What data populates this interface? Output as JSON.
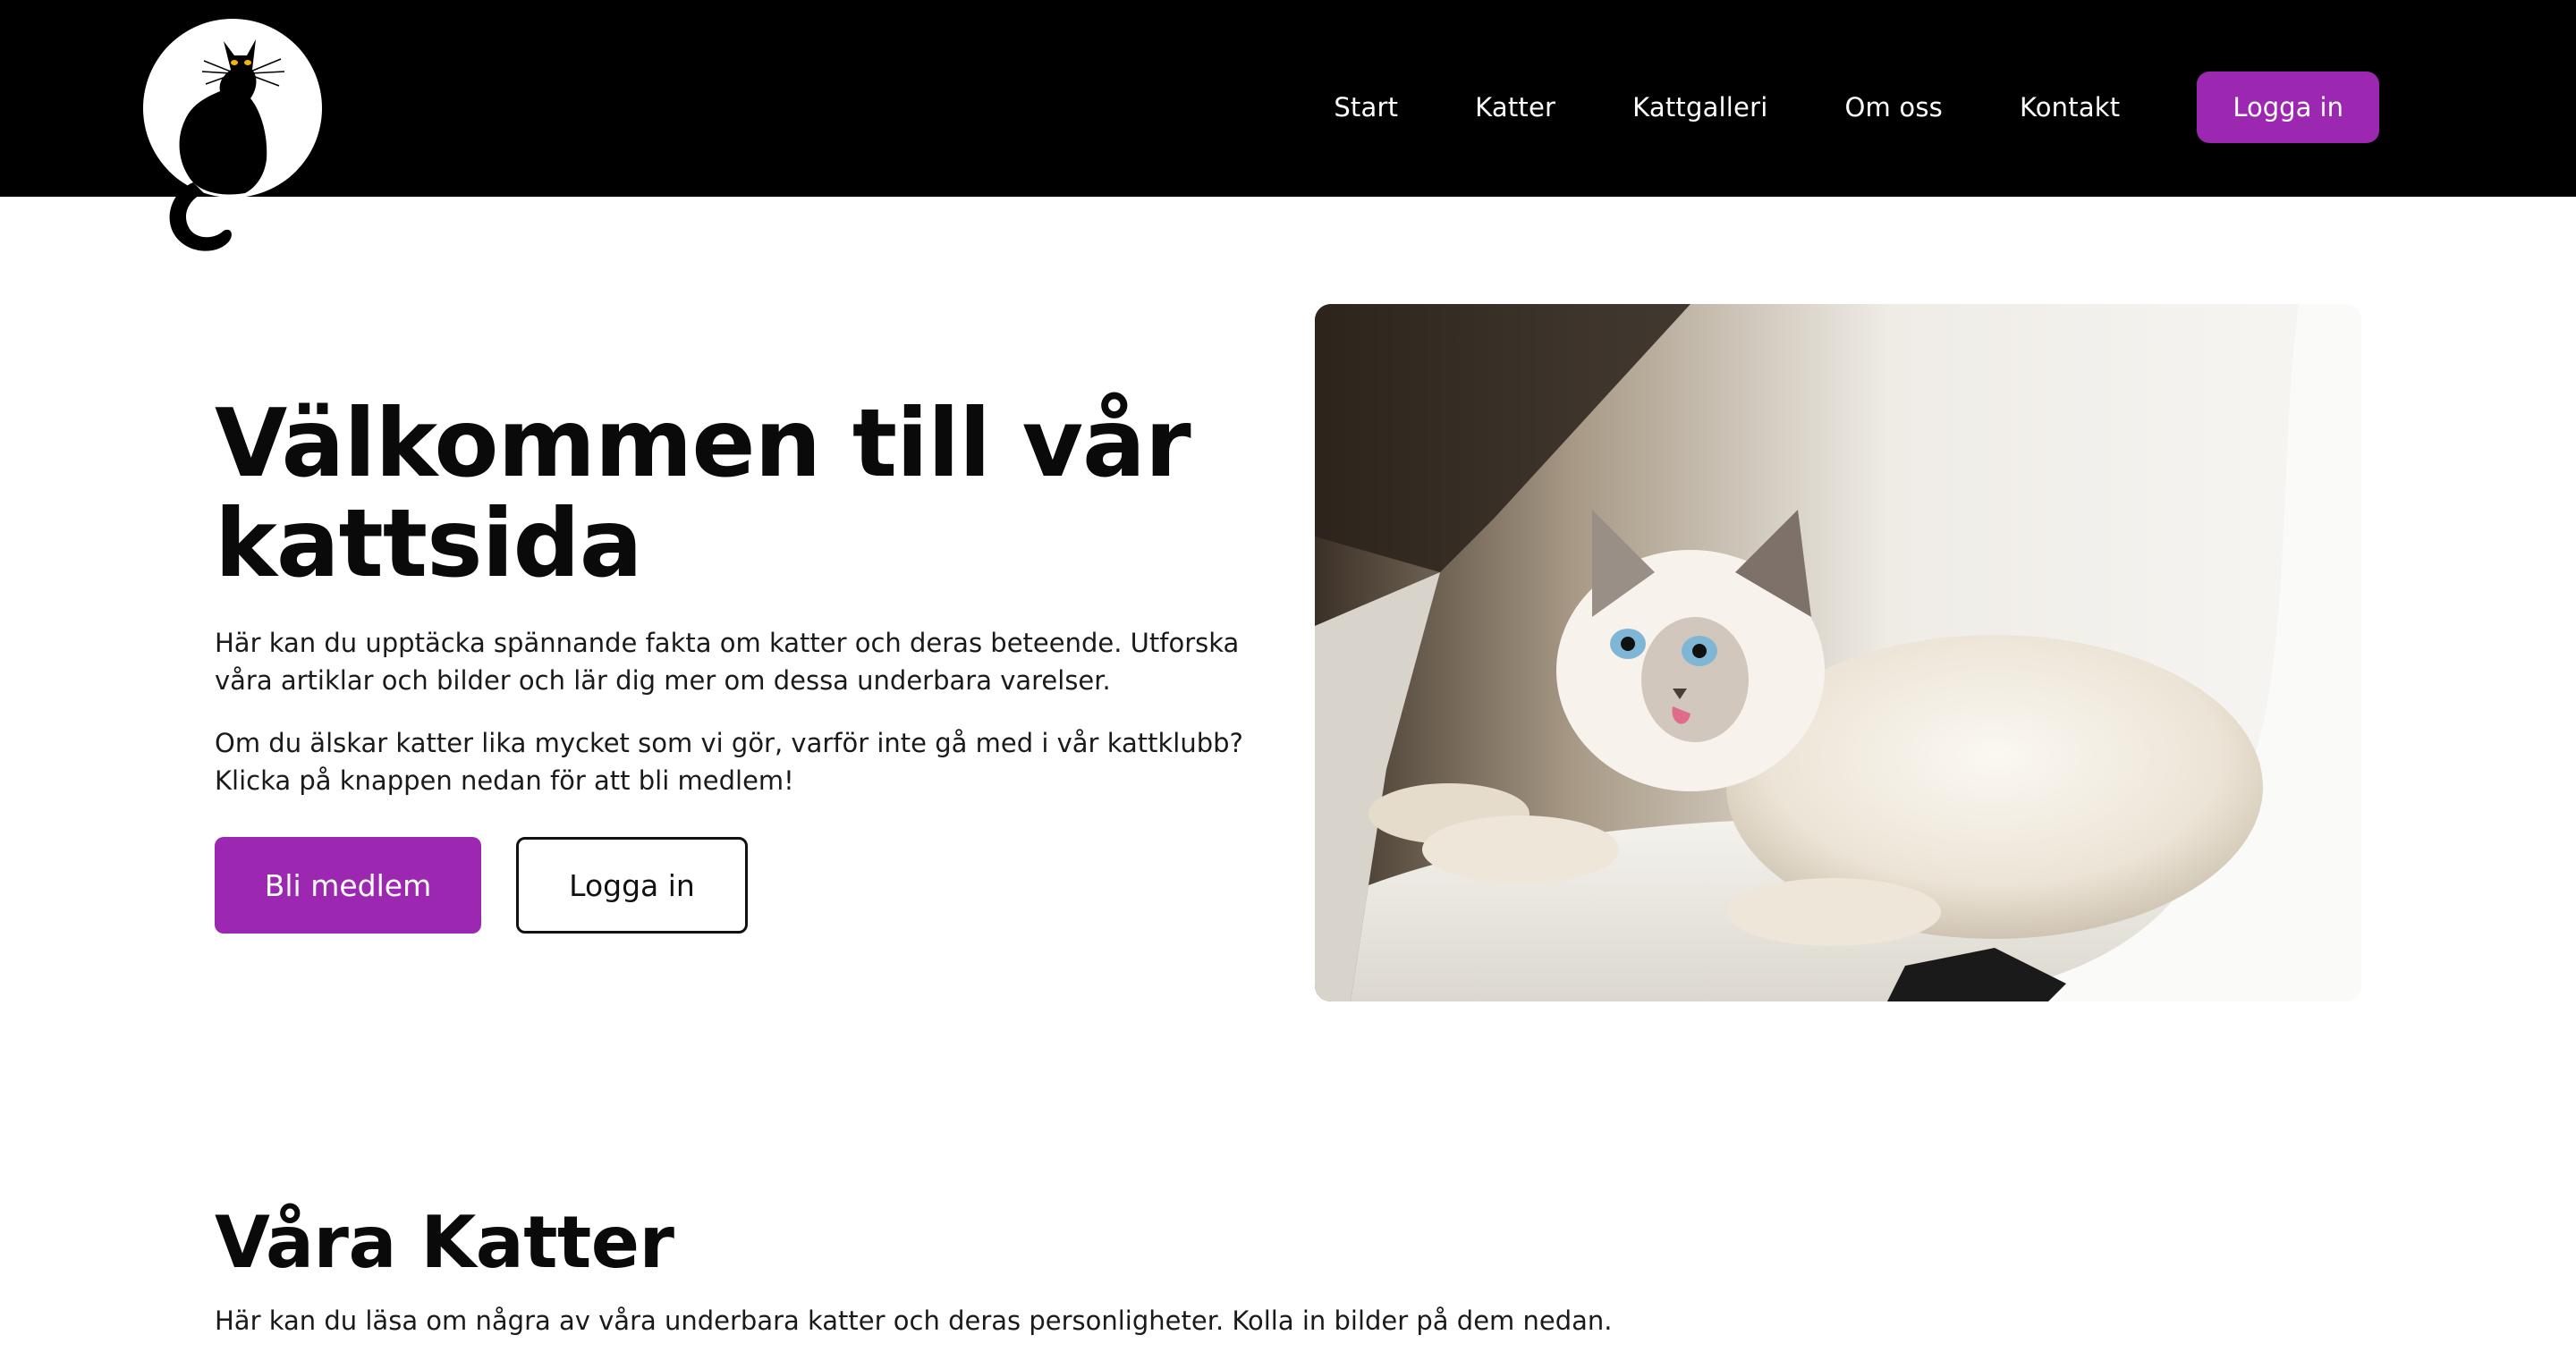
{
  "header": {
    "logo_alt": "black-cat-logo",
    "nav": [
      {
        "label": "Start"
      },
      {
        "label": "Katter"
      },
      {
        "label": "Kattgalleri"
      },
      {
        "label": "Om oss"
      },
      {
        "label": "Kontakt"
      }
    ],
    "login_label": "Logga in"
  },
  "hero": {
    "title": "Välkommen till vår kattsida",
    "paragraph_1": "Här kan du upptäcka spännande fakta om katter och deras beteende. Utforska våra artiklar och bilder och lär dig mer om dessa underbara varelser.",
    "paragraph_2": "Om du älskar katter lika mycket som vi gör, varför inte gå med i vår kattklubb? Klicka på knappen nedan för att bli medlem!",
    "primary_button": "Bli medlem",
    "secondary_button": "Logga in",
    "image_subject": "fluffy-white-cat-on-chair"
  },
  "section": {
    "title": "Våra Katter",
    "text": "Här kan du läsa om några av våra underbara katter och deras personligheter. Kolla in bilder på dem nedan."
  },
  "colors": {
    "header_bg": "#000000",
    "accent": "#9c27b0",
    "page_bg": "#ffffff",
    "text": "#111111"
  }
}
